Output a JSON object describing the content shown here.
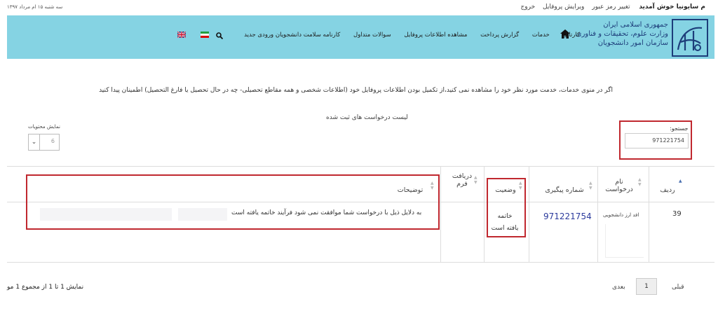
{
  "topbar": {
    "welcome": "م سایونیا خوش آمدید",
    "change_password": "تغییر رمز عبور",
    "edit_profile": "ویرایش پروفایل",
    "logout": "خروج",
    "date": "سه شنبه ۱۵ ام مرداد ۱۳۹۷"
  },
  "header": {
    "gov_line1": "جمهوری اسلامی ایران",
    "gov_line2": "وزارت علوم، تحقیقات و فناوری",
    "gov_line3": "سازمان امور دانشجویان",
    "nav": [
      "کارتابل",
      "خدمات",
      "گزارش پرداخت",
      "مشاهده اطلاعات پروفایل",
      "سوالات متداول",
      "کارنامه سلامت دانشجویان ورودی جدید"
    ],
    "brand_color": "#85d3e3"
  },
  "notice": "اگر در منوی خدمات، خدمت مورد نظر خود را مشاهده نمی کنید،از تکمیل بودن اطلاعات پروفایل خود (اطلاعات شخصی و همه مقاطع تحصیلی- چه در حال تحصیل یا فارغ التحصیل) اطمینان پیدا کنید",
  "list_title": "لیست درخواست های ثبت شده",
  "search": {
    "label": "جستجو:",
    "value": "971221754"
  },
  "page_size": {
    "label": "نمایش محتویات",
    "value": "6"
  },
  "table": {
    "headers": {
      "row": "ردیف",
      "name": "نام درخواست",
      "tracking": "شماره پیگیری",
      "status": "وضعیت",
      "form": "دریافت فرم",
      "description": "توضیحات"
    },
    "rows": [
      {
        "row": "39",
        "name": "افد ارز دانشجویی",
        "tracking": "971221754",
        "status": "خاتمه یافته است",
        "description": "به دلایل ذیل با درخواست شما موافقت نمی شود فرآیند خاتمه یافته است"
      }
    ]
  },
  "pagination": {
    "info": "نمایش 1 تا 1 از مجموع 1 مو",
    "prev": "قبلی",
    "next": "بعدی",
    "page": "1"
  },
  "accent": "#c0282f"
}
